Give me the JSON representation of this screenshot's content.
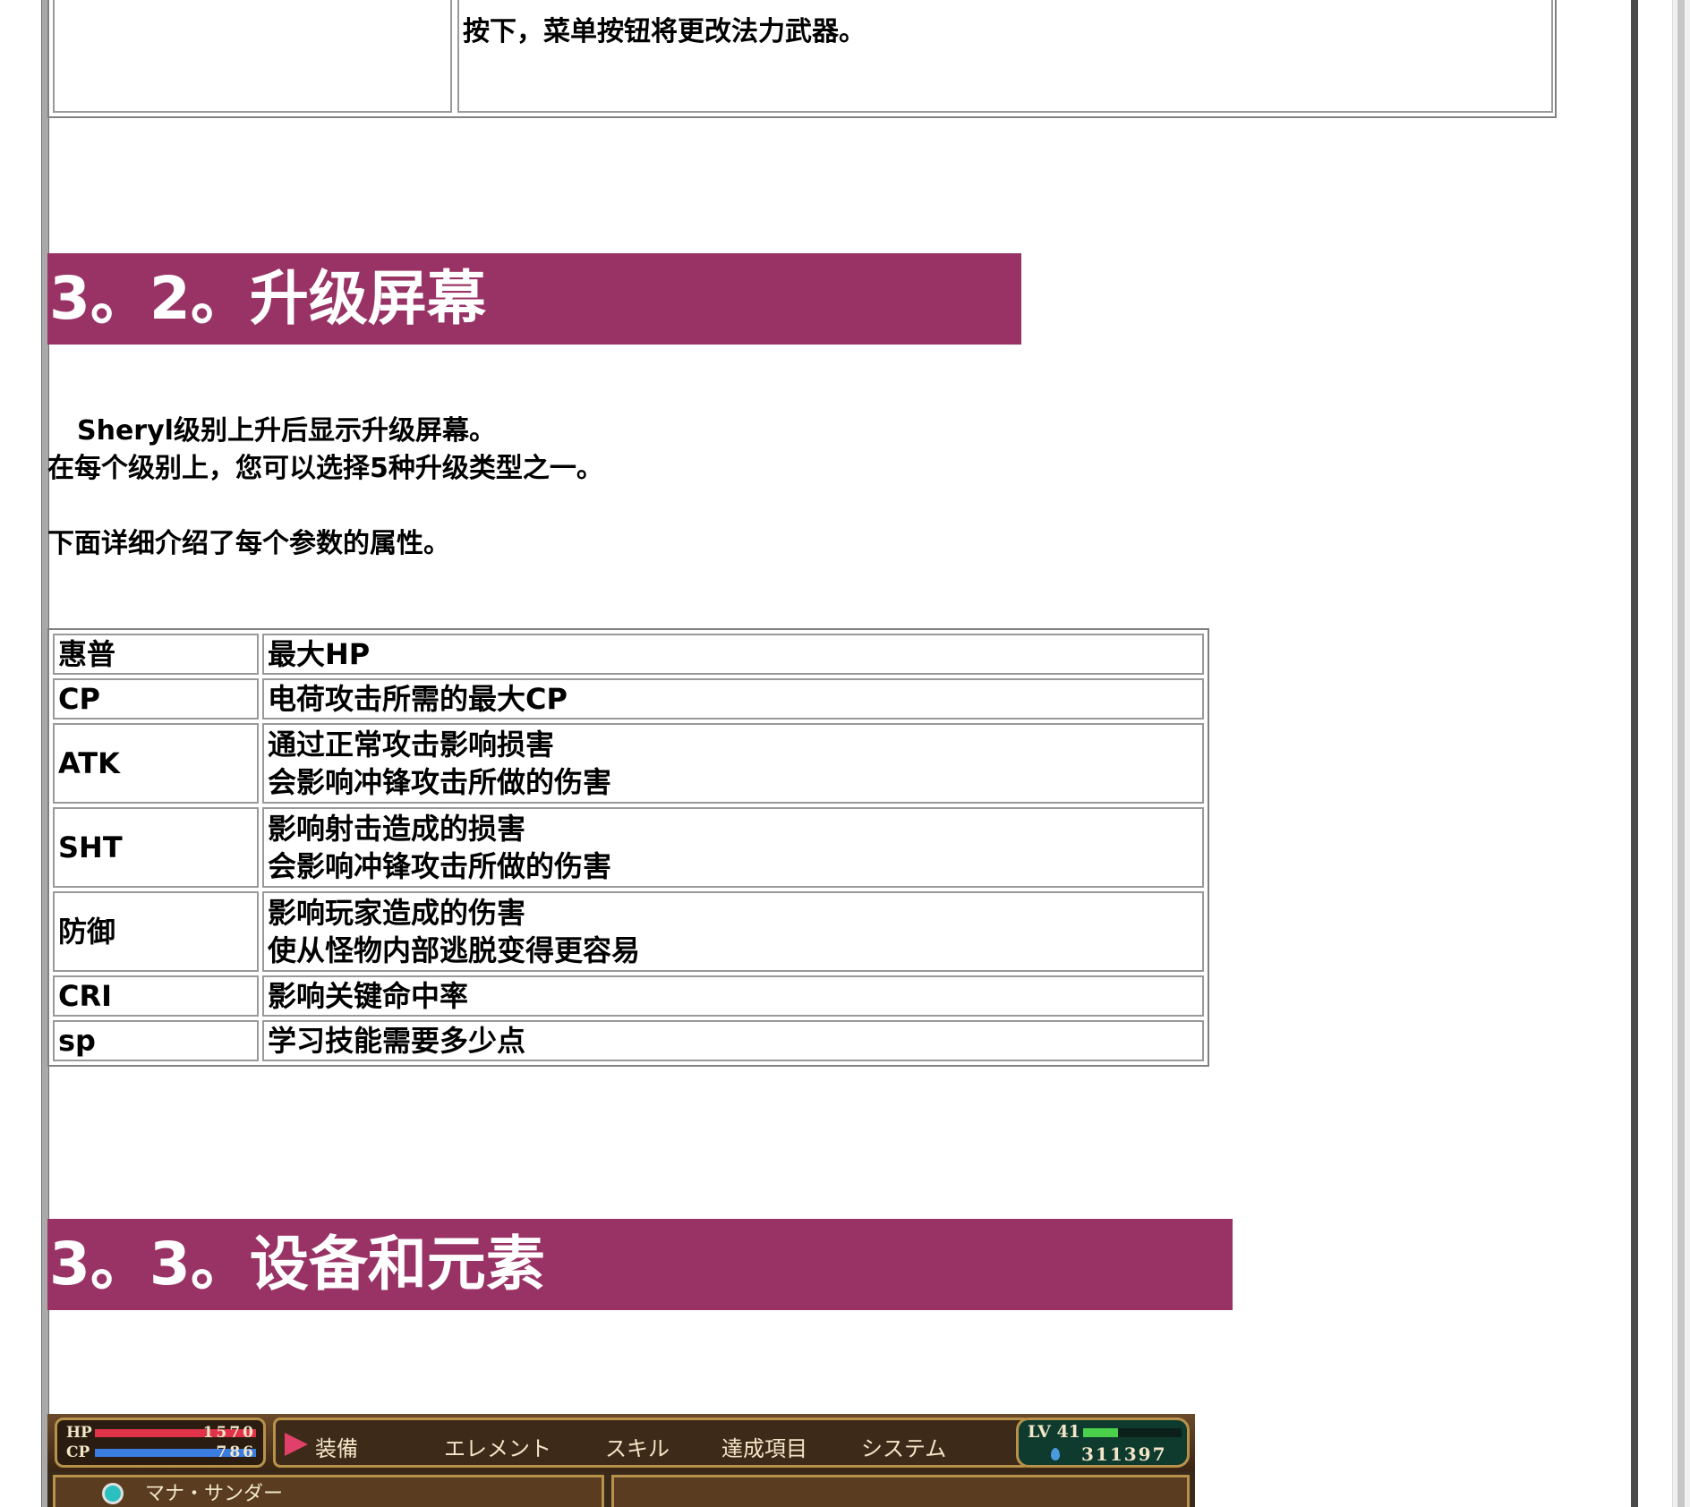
{
  "top_table": {
    "right_text": "按下，菜单按钮将更改法力武器。"
  },
  "section_3_2": {
    "heading": "3。2。升级屏幕",
    "para1": "Sheryl级别上升后显示升级屏幕。",
    "para2": "在每个级别上，您可以选择5种升级类型之一。",
    "para3": "下面详细介绍了每个参数的属性。"
  },
  "stats_table": {
    "rows": [
      {
        "key": "惠普",
        "desc": [
          "最大HP"
        ]
      },
      {
        "key": "CP",
        "desc": [
          "电荷攻击所需的最大CP"
        ]
      },
      {
        "key": "ATK",
        "desc": [
          "通过正常攻击影响损害",
          "会影响冲锋攻击所做的伤害"
        ]
      },
      {
        "key": "SHT",
        "desc": [
          "影响射击造成的损害",
          "会影响冲锋攻击所做的伤害"
        ]
      },
      {
        "key": "防御",
        "desc": [
          "影响玩家造成的伤害",
          "使从怪物内部逃脱变得更容易"
        ]
      },
      {
        "key": "CRI",
        "desc": [
          "影响关键命中率"
        ]
      },
      {
        "key": "sp",
        "desc": [
          "学习技能需要多少点"
        ]
      }
    ]
  },
  "section_3_3": {
    "heading": "3。3。设备和元素"
  },
  "game_hud": {
    "hp_label": "HP",
    "hp_value": "1570",
    "cp_label": "CP",
    "cp_value": "786",
    "menu": [
      "装備",
      "エレメント",
      "スキル",
      "達成項目",
      "システム"
    ],
    "level": "LV 41",
    "exp_fraction": 0.35,
    "gold": "311397",
    "panel_left_text": "マナ・サンダー",
    "accent_color": "#993366"
  }
}
